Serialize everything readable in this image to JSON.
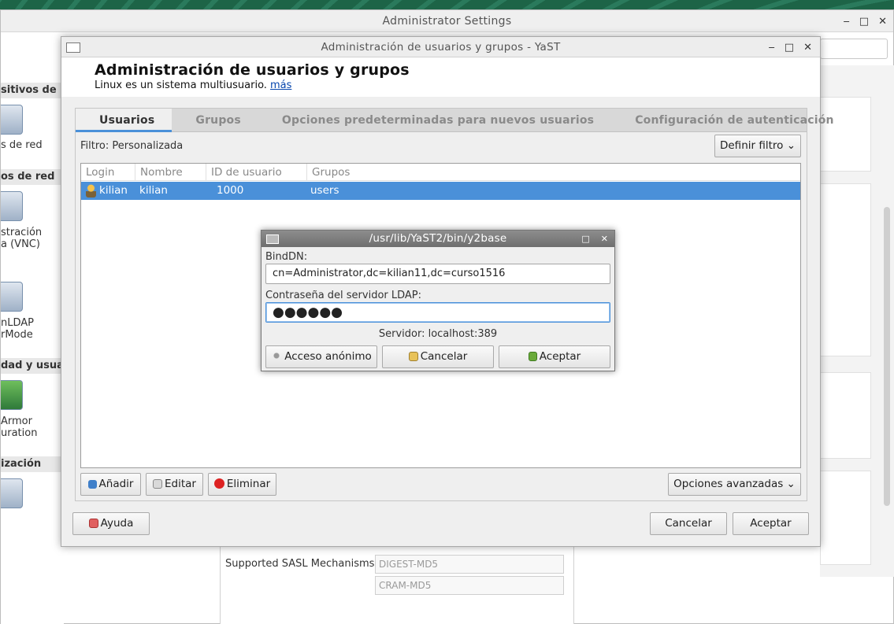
{
  "admin_window": {
    "title": "Administrator Settings",
    "controls": [
      "‒",
      "□",
      "✕"
    ],
    "left_sections": [
      {
        "heading": "sitivos de r",
        "labels": [
          "s de red"
        ]
      },
      {
        "heading": "os de red",
        "labels": [
          "stración",
          "a (VNC)",
          "nLDAP",
          "rMode"
        ]
      },
      {
        "heading": "dad y usua",
        "labels": [
          "Armor",
          "uration"
        ]
      },
      {
        "heading": "ización",
        "labels": []
      }
    ],
    "ldap_config": {
      "sasl_label": "Supported SASL Mechanisms",
      "sasl_values": [
        "DIGEST-MD5",
        "CRAM-MD5"
      ]
    }
  },
  "yast_window": {
    "title": "Administración de usuarios y grupos - YaST",
    "controls": [
      "‒",
      "□",
      "✕"
    ],
    "heading": "Administración de usuarios y grupos",
    "subheading": "Linux es un sistema multiusuario.",
    "more_link": "más",
    "tabs": [
      {
        "label": "Usuarios",
        "active": true
      },
      {
        "label": "Grupos",
        "active": false
      },
      {
        "label": "Opciones predeterminadas para nuevos usuarios",
        "active": false
      },
      {
        "label": "Configuración de autenticación",
        "active": false
      }
    ],
    "filter_label": "Filtro: Personalizada",
    "define_filter_button": "Definir filtro ⌄",
    "table": {
      "columns": [
        "Login",
        "Nombre",
        "ID de usuario",
        "Grupos"
      ],
      "rows": [
        {
          "login": "kilian",
          "name": "kilian",
          "uid": "1000",
          "groups": "users",
          "selected": true
        }
      ]
    },
    "add_button": "Añadir",
    "edit_button": "Editar",
    "delete_button": "Eliminar",
    "advanced_button": "Opciones avanzadas ⌄",
    "help_button": "Ayuda",
    "cancel_button": "Cancelar",
    "accept_button": "Aceptar"
  },
  "dialog": {
    "title": "/usr/lib/YaST2/bin/y2base",
    "controls": [
      "□",
      "✕"
    ],
    "binddn_label": "BindDN:",
    "binddn_value": "cn=Administrator,dc=kilian11,dc=curso1516",
    "password_label": "Contraseña del servidor LDAP:",
    "password_value": "●●●●●●",
    "server_text": "Servidor: localhost:389",
    "anonymous_button": "Acceso anónimo",
    "cancel_button": "Cancelar",
    "accept_button": "Aceptar"
  },
  "colors": {
    "selection": "#4a90d9",
    "link": "#0645ad",
    "desktop": "#1f6b4f"
  }
}
